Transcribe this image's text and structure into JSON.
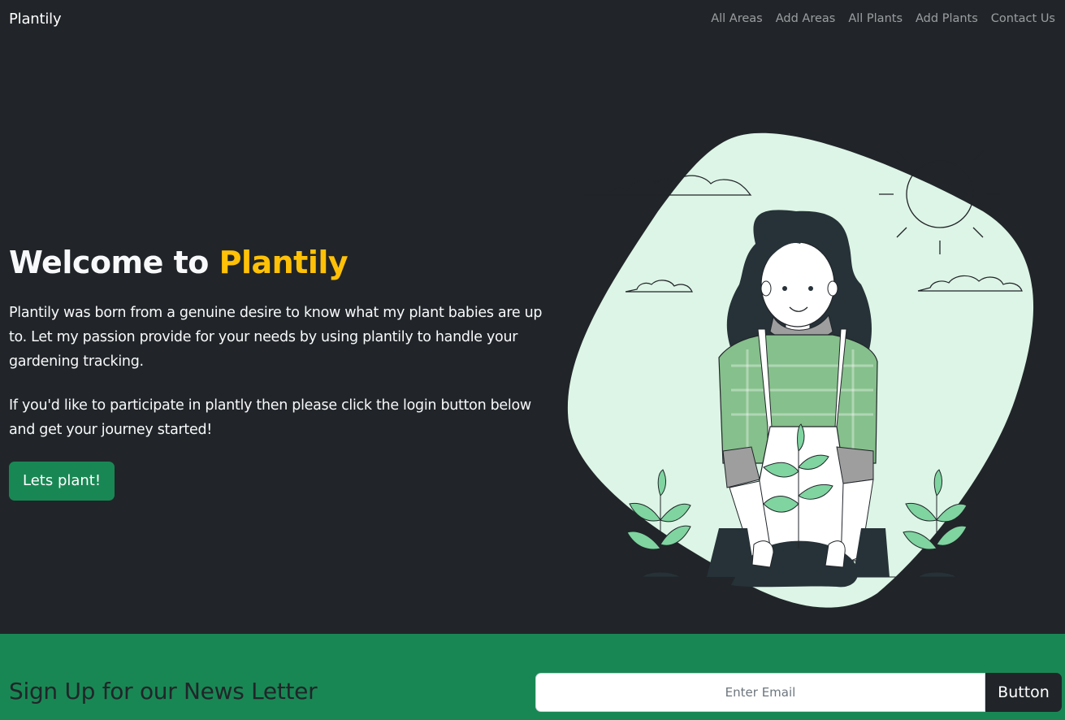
{
  "navbar": {
    "brand": "Plantily",
    "links": [
      "All Areas",
      "Add Areas",
      "All Plants",
      "Add Plants",
      "Contact Us"
    ]
  },
  "hero": {
    "title_prefix": "Welcome to",
    "title_accent": "Plantily",
    "paragraph_1": "Plantily was born from a genuine desire to know what my plant babies are up to. Let my passion provide for your needs by using plantily to handle your gardening tracking.",
    "paragraph_2": "If you'd like to participate in plantly then please click the login button below and get your journey started!",
    "cta_label": "Lets plant!"
  },
  "illustration": {
    "icon": "gardening-woman-illustration"
  },
  "newsletter": {
    "title": "Sign Up for our News Letter",
    "email_placeholder": "Enter Email",
    "button_label": "Button"
  },
  "colors": {
    "background": "#212529",
    "accent_yellow": "#ffc107",
    "brand_green": "#198754",
    "blob_mint": "#ddf5e6",
    "leaf_green": "#7fd4a0"
  }
}
